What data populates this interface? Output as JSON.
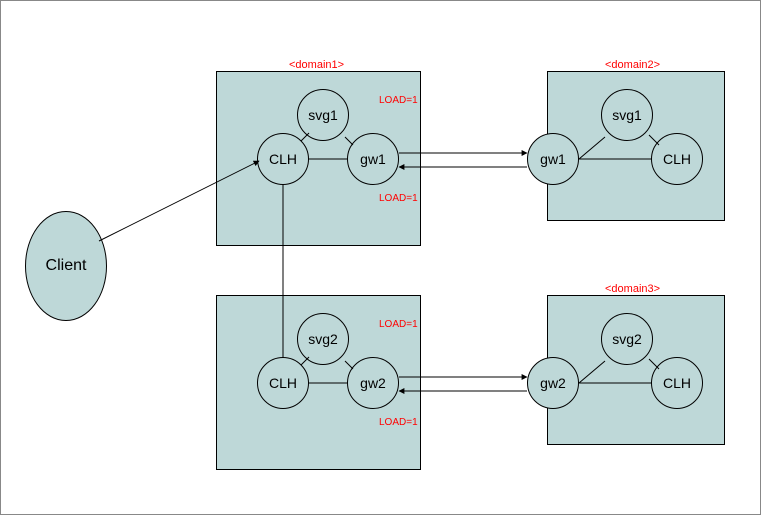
{
  "client": {
    "label": "Client"
  },
  "domains": {
    "d1": {
      "label": "<domain1>",
      "load_top": "LOAD=1",
      "load_bottom": "LOAD=1",
      "nodes": {
        "svg": "svg1",
        "clh": "CLH",
        "gw": "gw1"
      }
    },
    "d2": {
      "label": "<domain2>",
      "nodes": {
        "svg": "svg1",
        "clh": "CLH",
        "gw": "gw1"
      }
    },
    "d1b": {
      "load_top": "LOAD=1",
      "load_bottom": "LOAD=1",
      "nodes": {
        "svg": "svg2",
        "clh": "CLH",
        "gw": "gw2"
      }
    },
    "d3": {
      "label": "<domain3>",
      "nodes": {
        "svg": "svg2",
        "clh": "CLH",
        "gw": "gw2"
      }
    }
  }
}
